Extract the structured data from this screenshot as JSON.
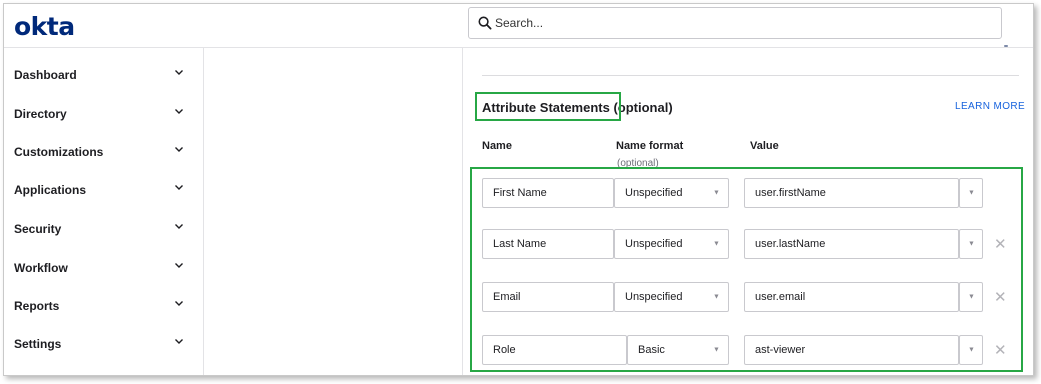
{
  "app": {
    "logo": "okta"
  },
  "search": {
    "placeholder": "Search..."
  },
  "sidebar": {
    "items": [
      {
        "label": "Dashboard"
      },
      {
        "label": "Directory"
      },
      {
        "label": "Customizations"
      },
      {
        "label": "Applications"
      },
      {
        "label": "Security"
      },
      {
        "label": "Workflow"
      },
      {
        "label": "Reports"
      },
      {
        "label": "Settings"
      }
    ]
  },
  "section": {
    "title": "Attribute Statements (optional)",
    "learn_more": "LEARN MORE"
  },
  "columns": {
    "name": "Name",
    "name_format": "Name format",
    "name_format_sub": "(optional)",
    "value": "Value"
  },
  "rows": [
    {
      "name": "First Name",
      "format": "Unspecified",
      "value": "user.firstName",
      "removable": false
    },
    {
      "name": "Last Name",
      "format": "Unspecified",
      "value": "user.lastName",
      "removable": true
    },
    {
      "name": "Email",
      "format": "Unspecified",
      "value": "user.email",
      "removable": true
    },
    {
      "name": "Role",
      "format": "Basic",
      "value": "ast-viewer",
      "removable": true
    }
  ],
  "glyphs": {
    "caret": "▼",
    "remove": "✕"
  },
  "colors": {
    "brand": "#00297a",
    "link": "#1662dd",
    "highlight": "#27a745"
  }
}
